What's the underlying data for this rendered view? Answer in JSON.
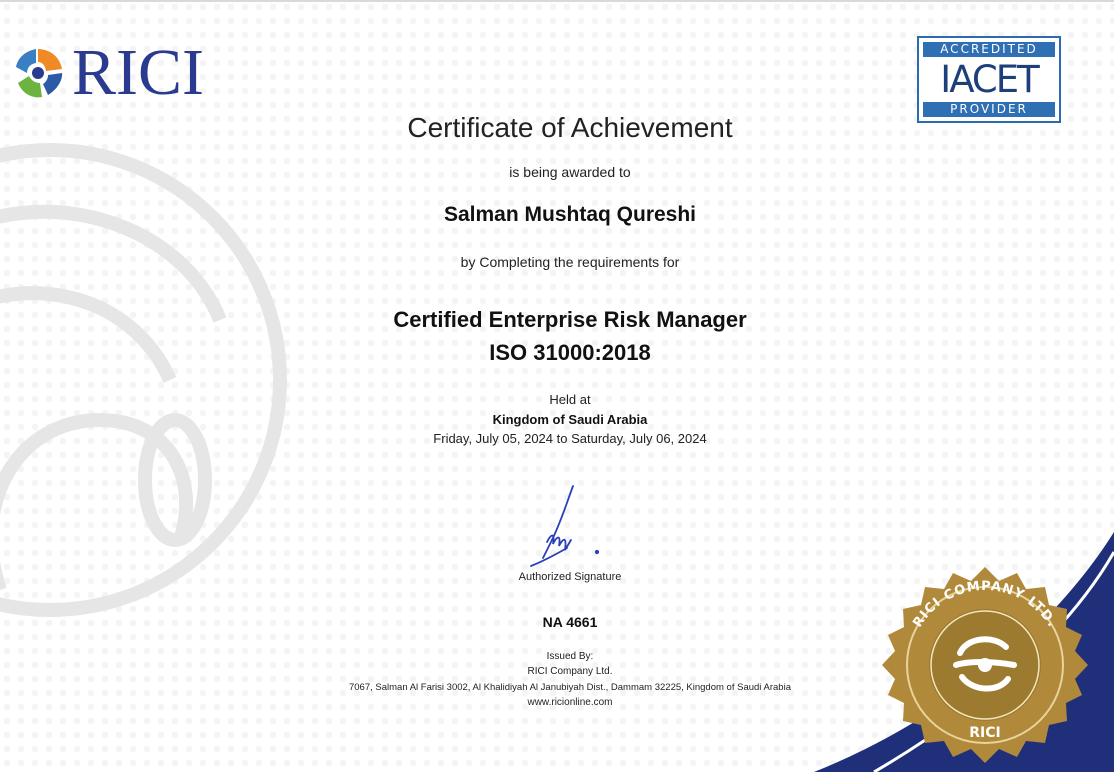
{
  "logo": {
    "wordmark": "RICI"
  },
  "accreditation": {
    "top": "ACCREDITED",
    "middle": "IACET",
    "bottom": "PROVIDER"
  },
  "certificate": {
    "title": "Certificate of Achievement",
    "awarded_text": "is being awarded to",
    "recipient": "Salman Mushtaq Qureshi",
    "completing_text": "by Completing the requirements  for",
    "course_line_1": "Certified Enterprise Risk Manager",
    "course_line_2": "ISO 31000:2018",
    "held_at_label": "Held at",
    "venue": "Kingdom of Saudi Arabia",
    "dates": "Friday, July 05, 2024 to Saturday, July 06, 2024",
    "signature_label": "Authorized Signature",
    "certificate_number": "NA 4661"
  },
  "issuer": {
    "label": "Issued By:",
    "name": "RICI Company Ltd.",
    "address": "7067, Salman Al Farisi 3002, Al Khalidiyah Al Janubiyah Dist., Dammam 32225, Kingdom of Saudi Arabia",
    "website": "www.ricionline.com"
  },
  "seal": {
    "ring_text": "RICI COMPANY LTD.",
    "bottom_text": "RICI"
  },
  "colors": {
    "brand_blue": "#2a3a8f",
    "iacet_blue": "#2f6fb3",
    "seal_gold": "#b08a3a",
    "corner_navy": "#1f2f7a",
    "signature_blue": "#2740b8"
  },
  "icons": {
    "logo_mark": "rici-logo-icon",
    "seal": "rici-seal-icon",
    "signature": "signature-image"
  }
}
